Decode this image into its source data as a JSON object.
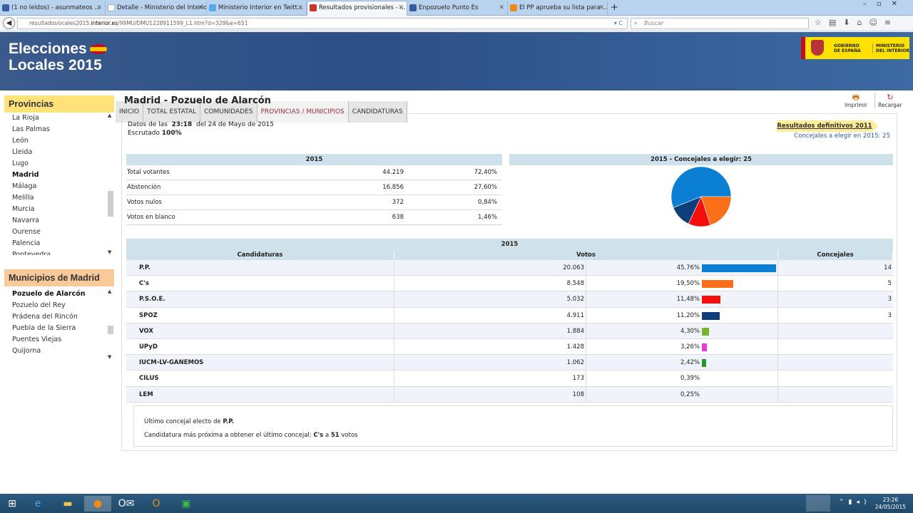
{
  "browser": {
    "tabs": [
      {
        "label": "(1 no leídos) - asunmateos ...",
        "color": "#3b5ea8"
      },
      {
        "label": "Detalle - Ministerio del Interior",
        "color": "#ffffff"
      },
      {
        "label": "Ministerio Interior en Twitt...",
        "color": "#55acee"
      },
      {
        "label": "Resultados provisionales - ...",
        "color": "#c9352c"
      },
      {
        "label": "Enpozuelo Punto Es",
        "color": "#3b5998"
      },
      {
        "label": "El PP aprueba su lista para ...",
        "color": "#f08a1c"
      }
    ],
    "url_prefix": "resultadoslocales2015.",
    "url_domain": "interior.es",
    "url_rest": "/99MU/DMU1228911599_L1.htm?d=329&e=651",
    "search_placeholder": "Buscar"
  },
  "site": {
    "logo_line1": "Elecciones",
    "logo_line2": "Locales 2015",
    "gov_line1": "GOBIERNO",
    "gov_line2": "DE ESPAÑA",
    "min_line1": "MINISTERIO",
    "min_line2": "DEL INTERIOR",
    "nav": [
      "INICIO",
      "TOTAL ESTATAL",
      "COMUNIDADES",
      "PROVINCIAS / MUNICIPIOS",
      "CANDIDATURAS"
    ]
  },
  "sidebar": {
    "prov_title": "Provincias",
    "provinces": [
      "La Rioja",
      "Las Palmas",
      "León",
      "Lleida",
      "Lugo",
      "Madrid",
      "Málaga",
      "Melilla",
      "Murcia",
      "Navarra",
      "Ourense",
      "Palencia",
      "Pontevedra"
    ],
    "selected_province": "Madrid",
    "muni_title": "Municipios de Madrid",
    "municipalities": [
      "Pozuelo de Alarcón",
      "Pozuelo del Rey",
      "Prádena del Rincón",
      "Puebla de la Sierra",
      "Puentes Viejas",
      "Quijorna"
    ],
    "selected_municipality": "Pozuelo de Alarcón"
  },
  "main": {
    "title": "Madrid - Pozuelo de Alarcón",
    "print_label": "Imprimir",
    "reload_label": "Recargar",
    "data_prefix": "Datos de las",
    "data_time": "23:18",
    "data_suffix": "del 24 de Mayo de 2015",
    "scrutiny_label": "Escrutado",
    "scrutiny_value": "100%",
    "results2011": "Resultados definitivos 2011",
    "concejales_label": "Concejales a elegir en 2015: 25",
    "summary_header": "2015",
    "summary": [
      {
        "label": "Total votantes",
        "value": "44.219",
        "pct": "72,40%"
      },
      {
        "label": "Abstención",
        "value": "16.856",
        "pct": "27,60%"
      },
      {
        "label": "Votos nulos",
        "value": "372",
        "pct": "0,84%"
      },
      {
        "label": "Votos en blanco",
        "value": "638",
        "pct": "1,46%"
      }
    ],
    "pie_header": "2015 - Concejales a elegir: 25",
    "cand_year": "2015",
    "cand_headers": {
      "name": "Candidaturas",
      "votes": "Votos",
      "seats": "Concejales"
    },
    "candidatures": [
      {
        "name": "P.P.",
        "votes": "20.063",
        "pct": "45,76%",
        "pct_value": 45.76,
        "seats": "14",
        "seats_n": 14,
        "color": "#0a7fd3"
      },
      {
        "name": "C's",
        "votes": "8.548",
        "pct": "19,50%",
        "pct_value": 19.5,
        "seats": "5",
        "seats_n": 5,
        "color": "#fb6f18"
      },
      {
        "name": "P.S.O.E.",
        "votes": "5.032",
        "pct": "11,48%",
        "pct_value": 11.48,
        "seats": "3",
        "seats_n": 3,
        "color": "#f50e0e"
      },
      {
        "name": "SPOZ",
        "votes": "4.911",
        "pct": "11,20%",
        "pct_value": 11.2,
        "seats": "3",
        "seats_n": 3,
        "color": "#0e3f7a"
      },
      {
        "name": "VOX",
        "votes": "1.884",
        "pct": "4,30%",
        "pct_value": 4.3,
        "seats": "",
        "seats_n": 0,
        "color": "#77b52a"
      },
      {
        "name": "UPyD",
        "votes": "1.428",
        "pct": "3,26%",
        "pct_value": 3.26,
        "seats": "",
        "seats_n": 0,
        "color": "#e93bd8"
      },
      {
        "name": "IUCM-LV-GANEMOS",
        "votes": "1.062",
        "pct": "2,42%",
        "pct_value": 2.42,
        "seats": "",
        "seats_n": 0,
        "color": "#1f9b2a"
      },
      {
        "name": "CILUS",
        "votes": "173",
        "pct": "0,39%",
        "pct_value": 0.39,
        "seats": "",
        "seats_n": 0,
        "color": "#888888"
      },
      {
        "name": "LEM",
        "votes": "108",
        "pct": "0,25%",
        "pct_value": 0.25,
        "seats": "",
        "seats_n": 0,
        "color": "#888888"
      }
    ],
    "last_seat_prefix": "Último concejal electo de",
    "last_seat_party": "P.P.",
    "next_prefix": "Candidatura más próxima a obtener el último concejal:",
    "next_party": "C's",
    "next_mid": "a",
    "next_votes": "51",
    "next_suffix": "votos"
  },
  "taskbar": {
    "time": "23:26",
    "date": "24/05/2015"
  }
}
